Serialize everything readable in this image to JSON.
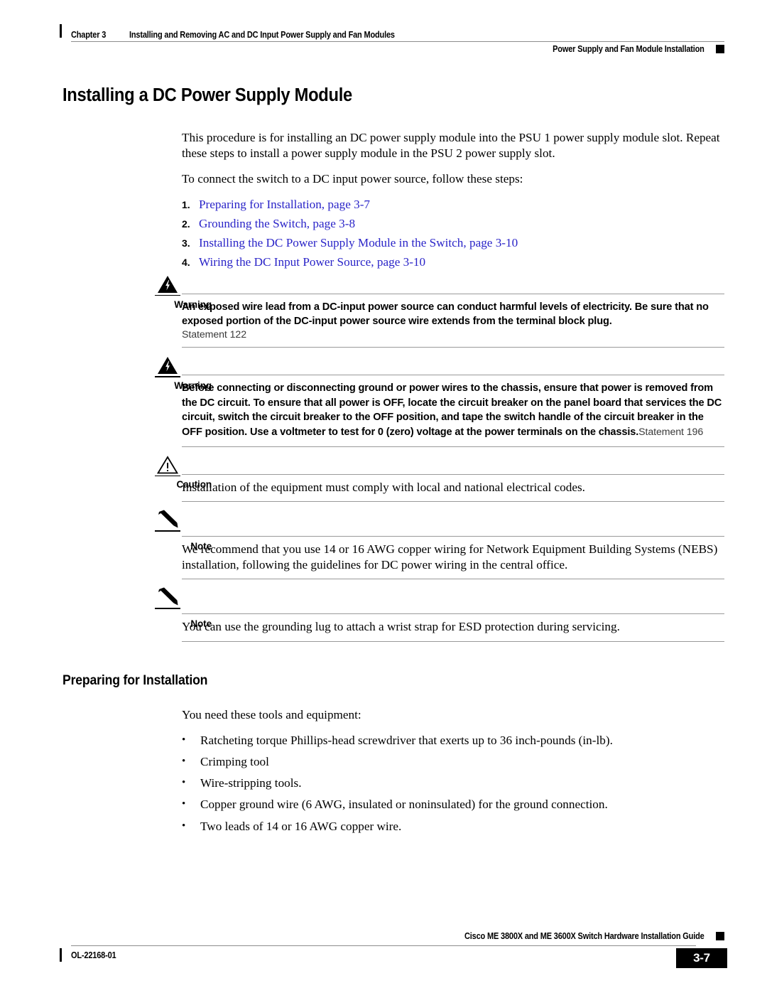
{
  "header": {
    "chapter": "Chapter 3",
    "chapter_title": "Installing and Removing AC and DC Input Power Supply and Fan Modules",
    "section": "Power Supply and Fan Module Installation"
  },
  "title": "Installing a DC Power Supply Module",
  "intro": {
    "paragraph1": "This procedure is for installing an DC power supply module into the PSU 1 power supply module slot. Repeat these steps to install a power supply module in the PSU 2 power supply slot.",
    "paragraph2": "To connect the switch to a DC input power source, follow these steps:"
  },
  "steps": [
    {
      "num": "1.",
      "text": "Preparing for Installation, page 3-7"
    },
    {
      "num": "2.",
      "text": "Grounding the Switch, page 3-8"
    },
    {
      "num": "3.",
      "text": "Installing the DC Power Supply Module in the Switch, page 3-10"
    },
    {
      "num": "4.",
      "text": "Wiring the DC Input Power Source, page 3-10"
    }
  ],
  "admonitions": [
    {
      "label": "Warning",
      "icon": "warning-lightning-triangle-icon",
      "text": "An exposed wire lead from a DC-input power source can conduct harmful levels of electricity. Be sure that no exposed portion of the DC-input power source wire extends from the terminal block plug.",
      "statement": "Statement 122"
    },
    {
      "label": "Warning",
      "icon": "warning-lightning-triangle-icon",
      "text": "Before connecting or disconnecting ground or power wires to the chassis, ensure that power is removed from the DC circuit. To ensure that all power is OFF, locate the circuit breaker on the panel board that services the DC circuit, switch the circuit breaker to the OFF position, and tape the switch handle of the circuit breaker in the OFF position. Use a voltmeter to test for 0 (zero) voltage at the power terminals on the chassis.",
      "statement": "Statement 196"
    },
    {
      "label": "Caution",
      "icon": "caution-exclamation-triangle-icon",
      "text": "Installation of the equipment must comply with local and national electrical codes.",
      "statement": ""
    },
    {
      "label": "Note",
      "icon": "note-pencil-icon",
      "text": "We recommend that you use 14 or 16 AWG copper wiring for Network Equipment Building Systems (NEBS) installation, following the guidelines for DC power wiring in the central office.",
      "statement": ""
    },
    {
      "label": "Note",
      "icon": "note-pencil-icon",
      "text": "You can use the grounding lug to attach a wrist strap for ESD protection during servicing.",
      "statement": ""
    }
  ],
  "section2": {
    "heading": "Preparing for Installation",
    "lead": "You need these tools and equipment:",
    "bullet_glyph": "•",
    "items": [
      "Ratcheting torque Phillips-head screwdriver that exerts up to 36 inch-pounds (in-lb).",
      "Crimping tool",
      "Wire-stripping tools.",
      "Copper ground wire (6 AWG, insulated or noninsulated) for the ground connection.",
      "Two leads of 14 or 16 AWG copper wire."
    ]
  },
  "footer": {
    "doc_id": "OL-22168-01",
    "guide_title": "Cisco ME 3800X and ME 3600X Switch Hardware Installation Guide",
    "page_number": "3-7"
  },
  "colors": {
    "link": "#2a24c8",
    "rule": "#9a9a9a",
    "text": "#000000"
  }
}
